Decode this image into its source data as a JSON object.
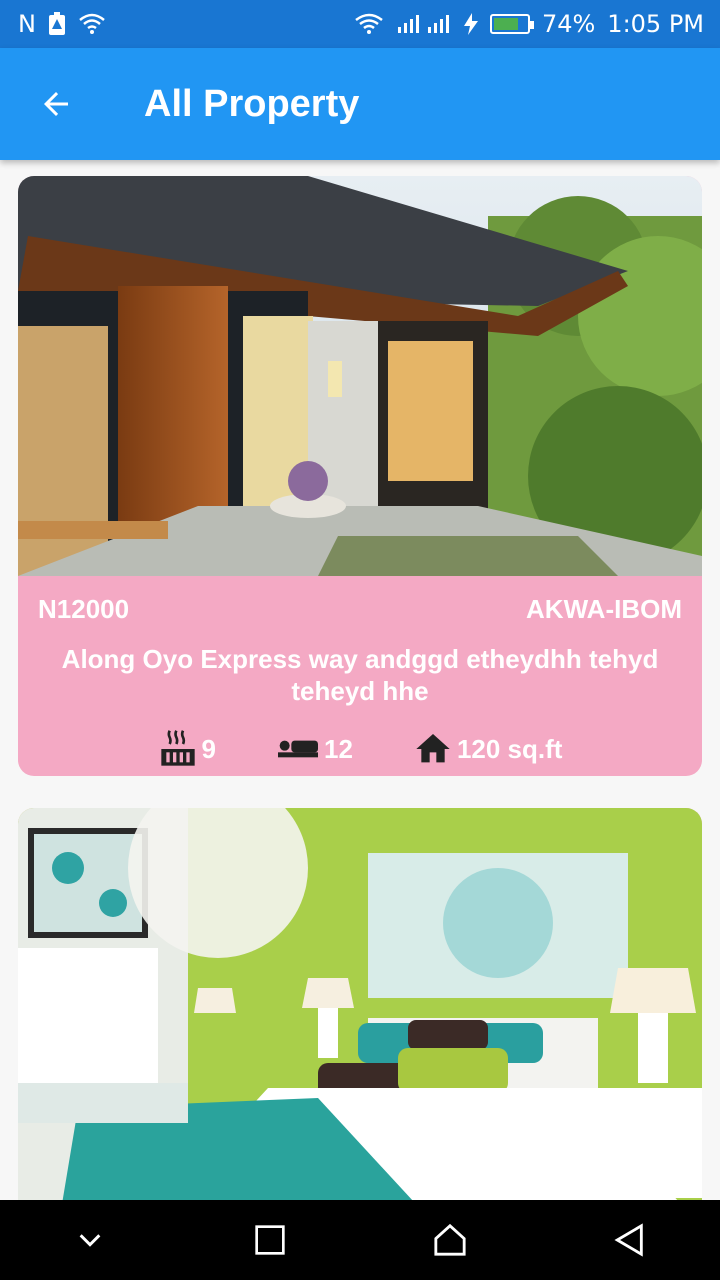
{
  "status_bar": {
    "carrier_glyph": "N",
    "battery_percent": "74%",
    "battery_level": 0.74,
    "time": "1:05 PM"
  },
  "app_bar": {
    "title": "All Property",
    "back_icon": "arrow-back-icon"
  },
  "listings": [
    {
      "price": "N12000",
      "state": "AKWA-IBOM",
      "address": "Along Oyo Express way andggd etheydhh tehyd teheyd hhe",
      "toilets": "9",
      "beds": "12",
      "area": "120 sq.ft",
      "photo_icon": "house-exterior-photo"
    },
    {
      "photo_icon": "bedroom-interior-photo"
    }
  ],
  "colors": {
    "status_bar": "#1976d2",
    "app_bar": "#2196f3",
    "card": "#f4a9c4",
    "battery": "#4caf50"
  },
  "nav_bar": {
    "icons": [
      "chevron-down-icon",
      "recents-icon",
      "home-icon",
      "back-icon"
    ]
  }
}
